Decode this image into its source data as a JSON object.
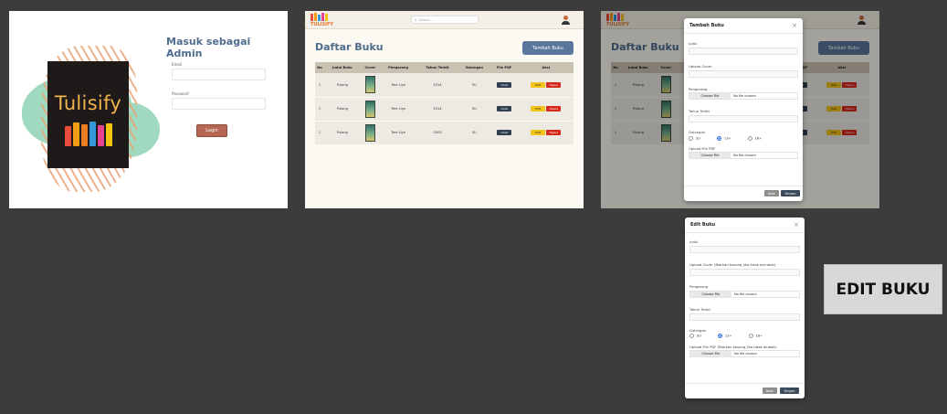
{
  "login": {
    "brand": "Tulisify",
    "title": "Masuk sebagai Admin",
    "email_label": "Email",
    "password_label": "Password",
    "login_button": "Login",
    "book_colors": [
      "#e74c3c",
      "#f39c12",
      "#e67e22",
      "#3498db",
      "#e84393",
      "#f1c40f"
    ]
  },
  "list": {
    "logo_word": "TULISIFY",
    "search_placeholder": "Search...",
    "page_title": "Daftar Buku",
    "add_button": "Tambah Buku",
    "columns": [
      "No",
      "Judul Buku",
      "Cover",
      "Pengarang",
      "Tahun Terbit",
      "Golongan",
      "File PDF",
      "Aksi"
    ],
    "rows": [
      {
        "no": "1",
        "judul": "Pulang",
        "pengarang": "Tere Liye",
        "tahun": "2014",
        "golongan": "SU",
        "pdf": "Lihat",
        "edit": "Edit",
        "hapus": "Hapus"
      },
      {
        "no": "1",
        "judul": "Pulang",
        "pengarang": "Tere Liye",
        "tahun": "2014",
        "golongan": "SU",
        "pdf": "Lihat",
        "edit": "Edit",
        "hapus": "Hapus"
      },
      {
        "no": "1",
        "judul": "Pulang",
        "pengarang": "Tere Liye",
        "tahun": "2003",
        "golongan": "SU",
        "pdf": "Lihat",
        "edit": "Edit",
        "hapus": "Hapus"
      }
    ]
  },
  "tambah_modal": {
    "title": "Tambah Buku",
    "judul_label": "Judul",
    "cover_label": "Upload Cover",
    "pengarang_label": "Pengarang",
    "choose_file": "Choose File",
    "no_file": "No file chosen",
    "tahun_label": "Tahun Terbit",
    "golongan_label": "Golongan",
    "golongan_options": [
      "SU",
      "13+",
      "18+"
    ],
    "pdf_label": "Upload File PDF",
    "cancel": "Batal",
    "save": "Simpan"
  },
  "edit_modal": {
    "title": "Edit Buku",
    "judul_label": "Judul",
    "cover_label": "Upload Cover (Biarkan kosong jika tidak berubah)",
    "pengarang_label": "Pengarang",
    "choose_file": "Choose File",
    "no_file": "No file chosen",
    "tahun_label": "Tahun Terbit",
    "golongan_label": "Golongan",
    "golongan_options": [
      "SU",
      "13+",
      "18+"
    ],
    "pdf_label": "Upload File PDF (Biarkan kosong jika tidak diubah)",
    "cancel": "Batal",
    "save": "Simpan"
  },
  "caption": "EDIT BUKU",
  "colors": {
    "accent_blue": "#4e6c8d",
    "button_blue": "#59779a",
    "login_brown": "#b76654",
    "edit_yellow": "#f0c419",
    "delete_red": "#d7281d",
    "pdf_dark": "#2f3f4f"
  }
}
